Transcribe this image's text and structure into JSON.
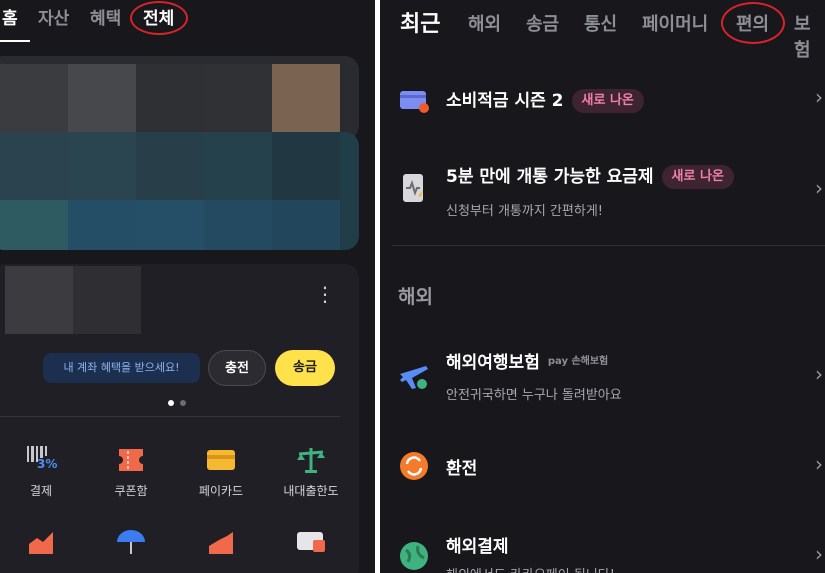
{
  "left": {
    "tabs": [
      "홈",
      "자산",
      "혜택",
      "전체"
    ],
    "promo": {
      "text": "내 계좌 혜택을 받으세요!",
      "charge": "충전",
      "send": "송금"
    },
    "more_icon": "⋮",
    "grid": [
      {
        "label": "결제",
        "icon": "barcode-icon",
        "badge": "3%"
      },
      {
        "label": "쿠폰함",
        "icon": "coupon-icon"
      },
      {
        "label": "페이카드",
        "icon": "card-icon"
      },
      {
        "label": "내대출한도",
        "icon": "scale-icon"
      }
    ],
    "colors": {
      "send_button": "#ffe14b",
      "annotation": "#d8232a"
    }
  },
  "right": {
    "tabs": [
      "최근",
      "해외",
      "송금",
      "통신",
      "페이머니",
      "편의",
      "보험"
    ],
    "rows": [
      {
        "title": "소비적금 시즌 2",
        "badge": "새로 나온",
        "icon": "wallet-icon"
      },
      {
        "title": "5분 만에 개통 가능한 요금제",
        "badge": "새로 나온",
        "sub": "신청부터 개통까지 간편하게!",
        "icon": "phone-plan-icon"
      }
    ],
    "section": "해외",
    "overseas": [
      {
        "title": "해외여행보험",
        "pay_tag": "pay 손해보험",
        "sub": "안전귀국하면 누구나 돌려받아요",
        "icon": "airplane-icon"
      },
      {
        "title": "환전",
        "icon": "exchange-icon"
      },
      {
        "title": "해외결제",
        "sub": "해외에서도 카카오페이 됩니다!",
        "icon": "globe-icon"
      }
    ],
    "chevron": "›"
  }
}
